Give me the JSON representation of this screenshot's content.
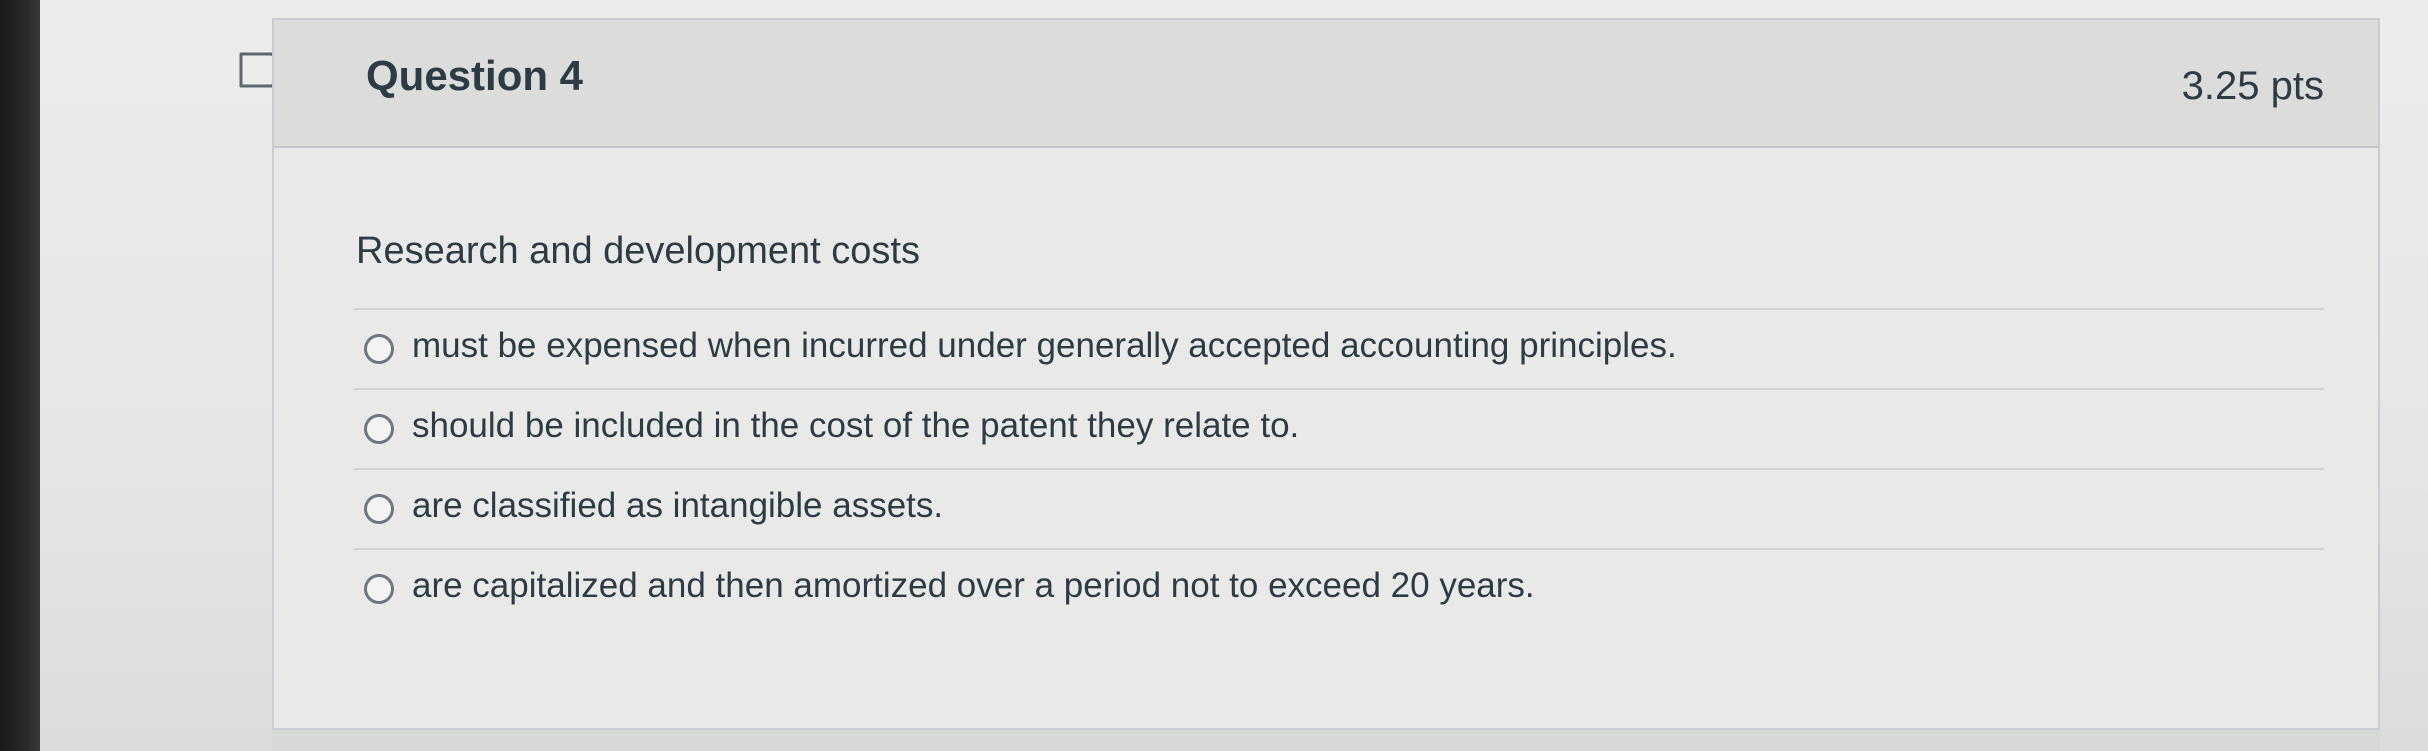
{
  "question": {
    "title": "Question 4",
    "points": "3.25 pts",
    "text": "Research and development costs",
    "answers": [
      {
        "label": "must be expensed when incurred under generally accepted accounting principles."
      },
      {
        "label": "should be included in the cost of the patent they relate to."
      },
      {
        "label": "are classified as intangible assets."
      },
      {
        "label": "are capitalized and then amortized over a period not to exceed 20 years."
      }
    ]
  },
  "icons": {
    "flag": "flag-outline-icon",
    "radio": "radio-unchecked-icon"
  },
  "colors": {
    "text": "#2d3b45",
    "header_bg": "#dcdcdb",
    "card_bg": "#e9e9e8",
    "border": "#c7cdd1",
    "radio_border": "#6b7780"
  }
}
